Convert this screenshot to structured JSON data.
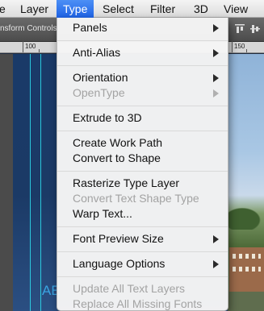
{
  "menubar": {
    "items": [
      {
        "label": "e"
      },
      {
        "label": "Layer"
      },
      {
        "label": "Type"
      },
      {
        "label": "Select"
      },
      {
        "label": "Filter"
      },
      {
        "label": "3D"
      },
      {
        "label": "View"
      }
    ]
  },
  "optionsbar": {
    "label": "nsform Controls"
  },
  "ruler": {
    "labels": [
      "100",
      "150"
    ]
  },
  "canvas": {
    "text": "AE"
  },
  "type_menu": {
    "items": [
      {
        "label": "Panels",
        "enabled": true,
        "submenu": true
      },
      {
        "label": "Anti-Alias",
        "enabled": true,
        "submenu": true
      },
      {
        "label": "Orientation",
        "enabled": true,
        "submenu": true
      },
      {
        "label": "OpenType",
        "enabled": false,
        "submenu": true
      },
      {
        "label": "Extrude to 3D",
        "enabled": true,
        "submenu": false
      },
      {
        "label": "Create Work Path",
        "enabled": true,
        "submenu": false
      },
      {
        "label": "Convert to Shape",
        "enabled": true,
        "submenu": false
      },
      {
        "label": "Rasterize Type Layer",
        "enabled": true,
        "submenu": false
      },
      {
        "label": "Convert Text Shape Type",
        "enabled": false,
        "submenu": false
      },
      {
        "label": "Warp Text...",
        "enabled": true,
        "submenu": false
      },
      {
        "label": "Font Preview Size",
        "enabled": true,
        "submenu": true
      },
      {
        "label": "Language Options",
        "enabled": true,
        "submenu": true
      },
      {
        "label": "Update All Text Layers",
        "enabled": false,
        "submenu": false
      },
      {
        "label": "Replace All Missing Fonts",
        "enabled": false,
        "submenu": false
      }
    ]
  },
  "icons": {
    "submenu_arrow": "triangle-right-icon",
    "align": "align-edges-icon"
  },
  "colors": {
    "menu_highlight": "#2a6ff0",
    "guide": "#2ee0f0",
    "disabled_text": "#a3a3a3"
  }
}
